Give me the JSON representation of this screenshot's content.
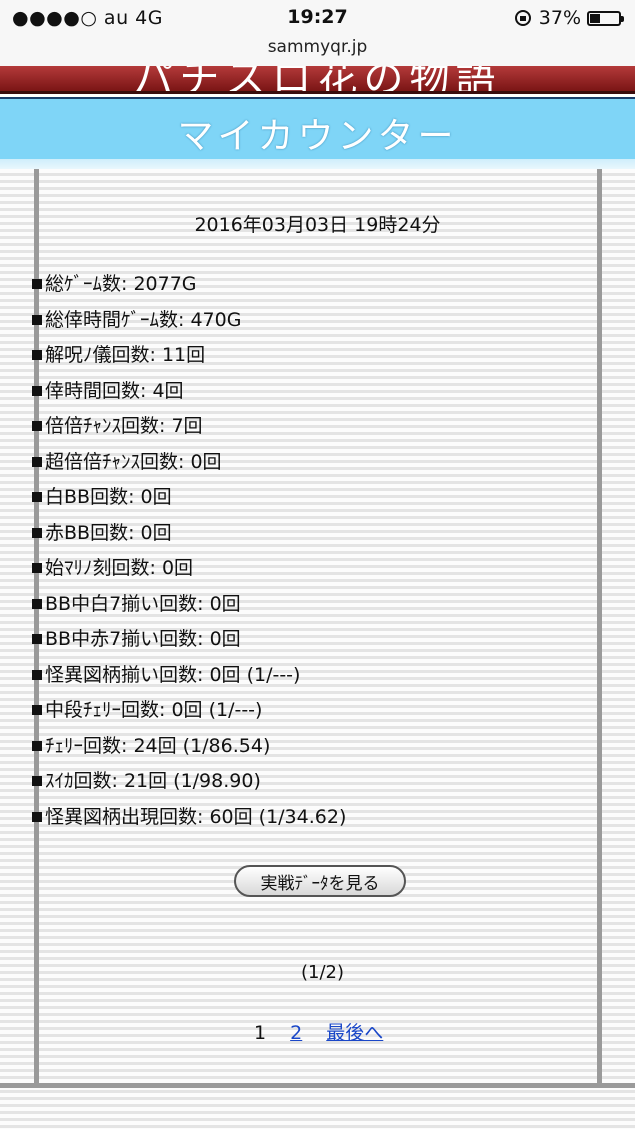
{
  "status_bar": {
    "carrier": "●●●●○ au 4G",
    "time": "19:27",
    "battery_text": "37%",
    "battery_level": 0.37
  },
  "url_bar": {
    "domain": "sammyqr.jp"
  },
  "header": {
    "banner_title": "パチスロ花の物語",
    "page_title": "マイカウンター"
  },
  "main": {
    "date": "2016年03月03日 19時24分",
    "stats": [
      "総ｹﾞｰﾑ数: 2077G",
      "総倖時間ｹﾞｰﾑ数: 470G",
      "解呪ﾉ儀回数: 11回",
      "倖時間回数: 4回",
      "倍倍ﾁｬﾝｽ回数: 7回",
      "超倍倍ﾁｬﾝｽ回数: 0回",
      "白BB回数: 0回",
      "赤BB回数: 0回",
      "始ﾏﾘﾉ刻回数: 0回",
      "BB中白7揃い回数: 0回",
      "BB中赤7揃い回数: 0回",
      "怪異図柄揃い回数: 0回 (1/---)",
      "中段ﾁｪﾘｰ回数: 0回 (1/---)",
      "ﾁｪﾘｰ回数: 24回 (1/86.54)",
      "ｽｲｶ回数: 21回 (1/98.90)",
      "怪異図柄出現回数: 60回 (1/34.62)"
    ],
    "view_button_label": "実戦ﾃﾞｰﾀを見る",
    "page_indicator": "(1/2)",
    "pager": {
      "current": "1",
      "page2": "2",
      "last": "最後へ"
    }
  }
}
